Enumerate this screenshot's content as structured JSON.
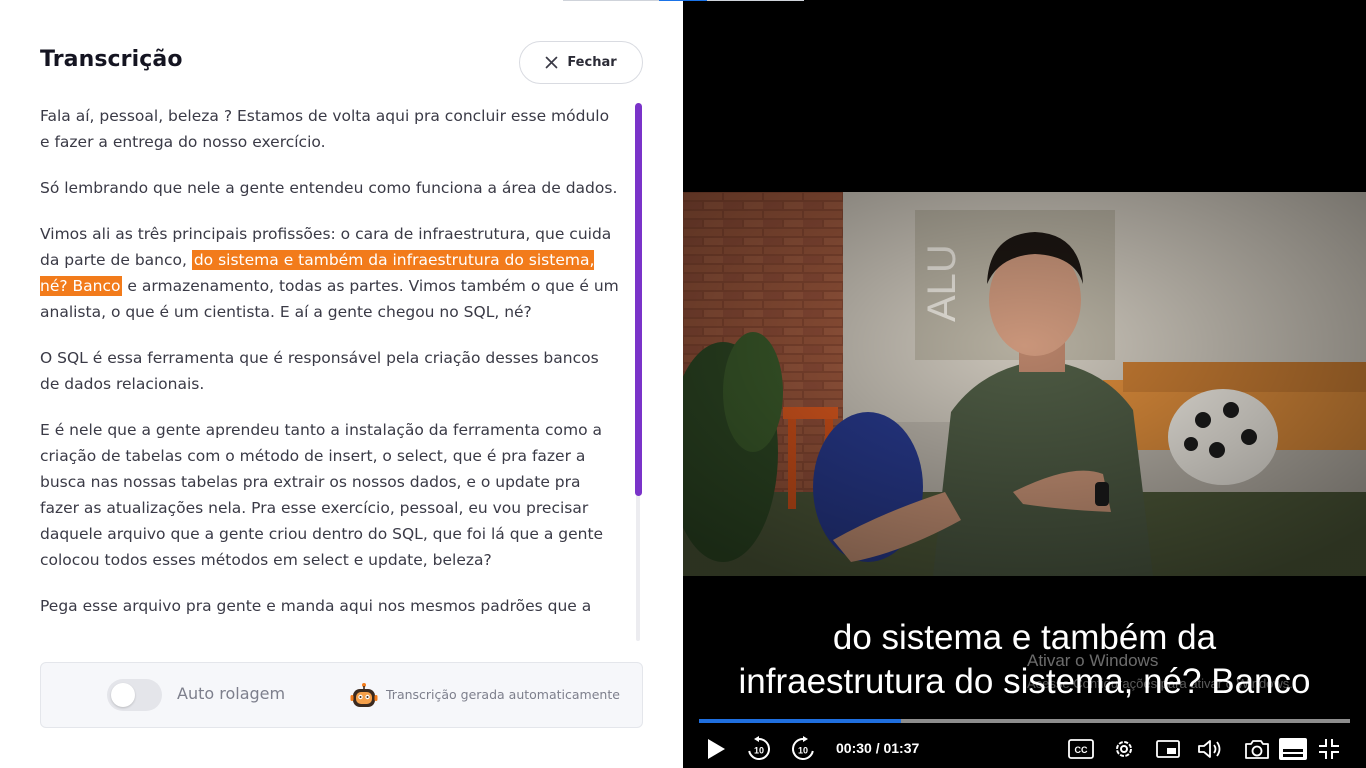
{
  "panel": {
    "title": "Transcrição",
    "close_label": "Fechar"
  },
  "transcript": {
    "paragraphs": [
      "Fala aí, pessoal, beleza ? Estamos de volta aqui pra concluir esse módulo e fazer a entrega do nosso exercício.",
      "Só lembrando que nele a gente entendeu como funciona a área de dados.",
      {
        "before": "Vimos ali as três principais profissões: o cara de infraestrutura, que cuida da parte de banco, ",
        "highlight": "do sistema e também da infraestrutura do sistema, né? Banco",
        "after": " e armazenamento, todas as partes. Vimos também o que é um analista, o que é um cientista. E aí a gente chegou no SQL, né?"
      },
      "O SQL é essa ferramenta que é responsável pela criação desses bancos de dados relacionais.",
      "E é nele que a gente aprendeu tanto a instalação da ferramenta como a criação de tabelas com o método de insert, o select, que é pra fazer a busca nas nossas tabelas pra extrair os nossos dados, e o update pra fazer as atualizações nela. Pra esse exercício, pessoal, eu vou precisar daquele arquivo que a gente criou dentro do SQL, que foi lá que a gente colocou todos esses métodos em select e update, beleza?",
      "Pega esse arquivo pra gente e manda aqui nos mesmos padrões que a"
    ]
  },
  "footer": {
    "auto_scroll_label": "Auto rolagem",
    "auto_scroll_on": false,
    "generated_label": "Transcrição gerada automaticamente",
    "robot_icon": "robot-icon"
  },
  "player": {
    "caption_line1": "do sistema e também da",
    "caption_line2": "infraestrutura do sistema, né? Banco",
    "watermark_line1": "Ativar o Windows",
    "watermark_line2": "Acesse Configurações para ativar o Windows.",
    "time_current": "00:30",
    "time_total": "01:37",
    "time_display": "00:30 / 01:37",
    "progress_fraction": 0.31,
    "rewind_seconds": "10",
    "forward_seconds": "10",
    "cc_label": "CC",
    "colors": {
      "progress_fill": "#1f6fdf",
      "highlight": "#f27b1b",
      "scroll_thumb": "#7a33c9"
    }
  }
}
